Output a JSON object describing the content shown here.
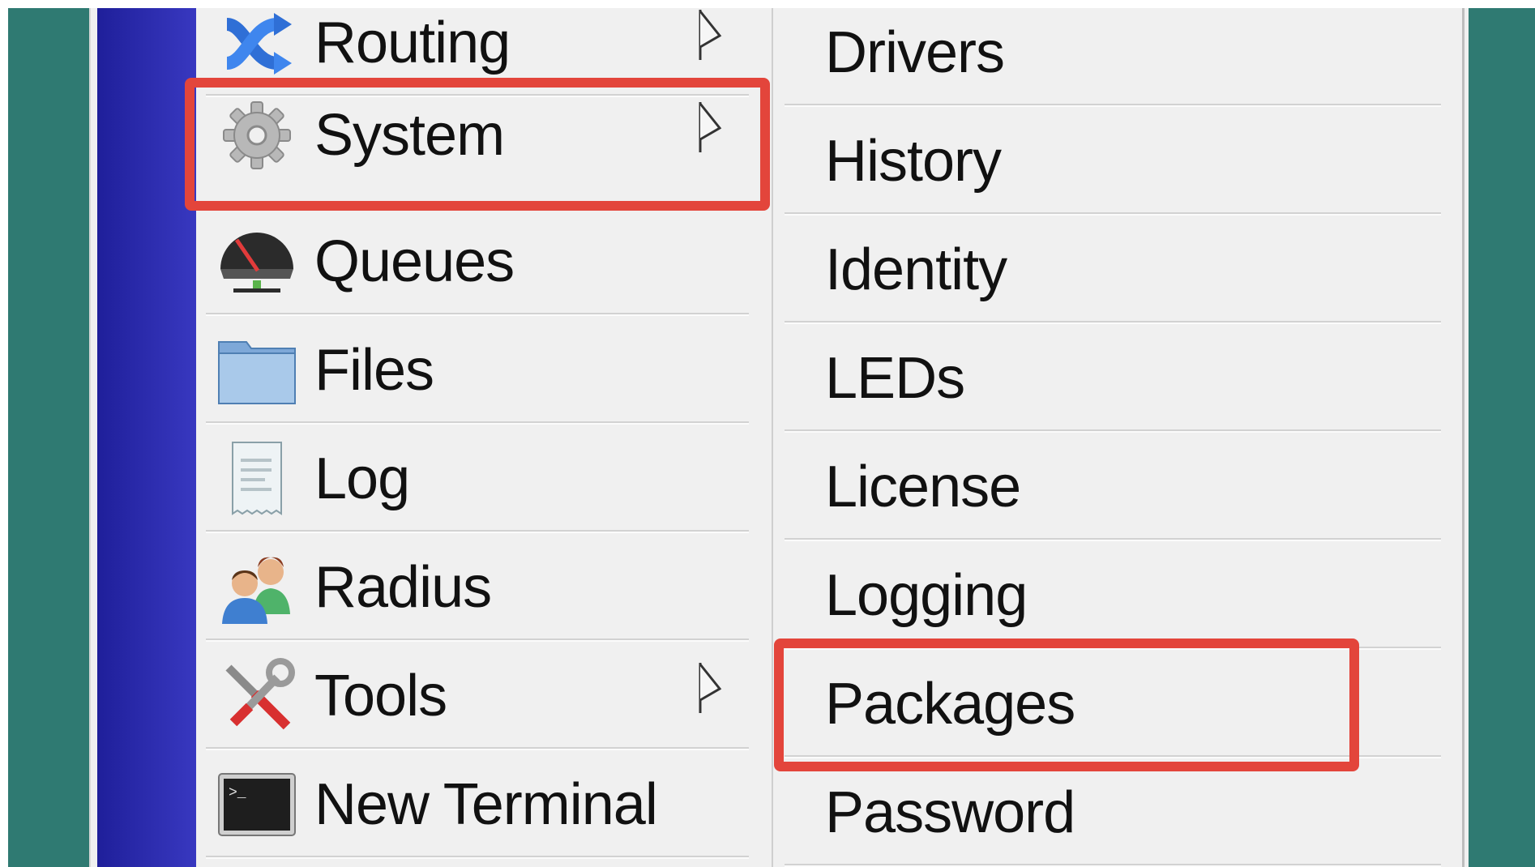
{
  "colors": {
    "background": "#2f7a72",
    "sidebar_gradient_dark": "#1f1f9a",
    "sidebar_gradient_light": "#3838c0",
    "menu_background": "#f0f0f0",
    "highlight": "#e3453b",
    "text": "#111111"
  },
  "main_menu": {
    "items": [
      {
        "label": "Routing",
        "icon": "routing-icon",
        "has_submenu": true
      },
      {
        "label": "System",
        "icon": "gear-icon",
        "has_submenu": true,
        "highlighted": true
      },
      {
        "label": "Queues",
        "icon": "queues-gauge-icon",
        "has_submenu": false
      },
      {
        "label": "Files",
        "icon": "folder-icon",
        "has_submenu": false
      },
      {
        "label": "Log",
        "icon": "log-document-icon",
        "has_submenu": false
      },
      {
        "label": "Radius",
        "icon": "users-icon",
        "has_submenu": false
      },
      {
        "label": "Tools",
        "icon": "tools-icon",
        "has_submenu": true
      },
      {
        "label": "New Terminal",
        "icon": "terminal-icon",
        "has_submenu": false
      }
    ]
  },
  "system_submenu": {
    "items": [
      {
        "label": "Drivers"
      },
      {
        "label": "History"
      },
      {
        "label": "Identity"
      },
      {
        "label": "LEDs"
      },
      {
        "label": "License"
      },
      {
        "label": "Logging"
      },
      {
        "label": "Packages",
        "highlighted": true
      },
      {
        "label": "Password"
      }
    ]
  }
}
